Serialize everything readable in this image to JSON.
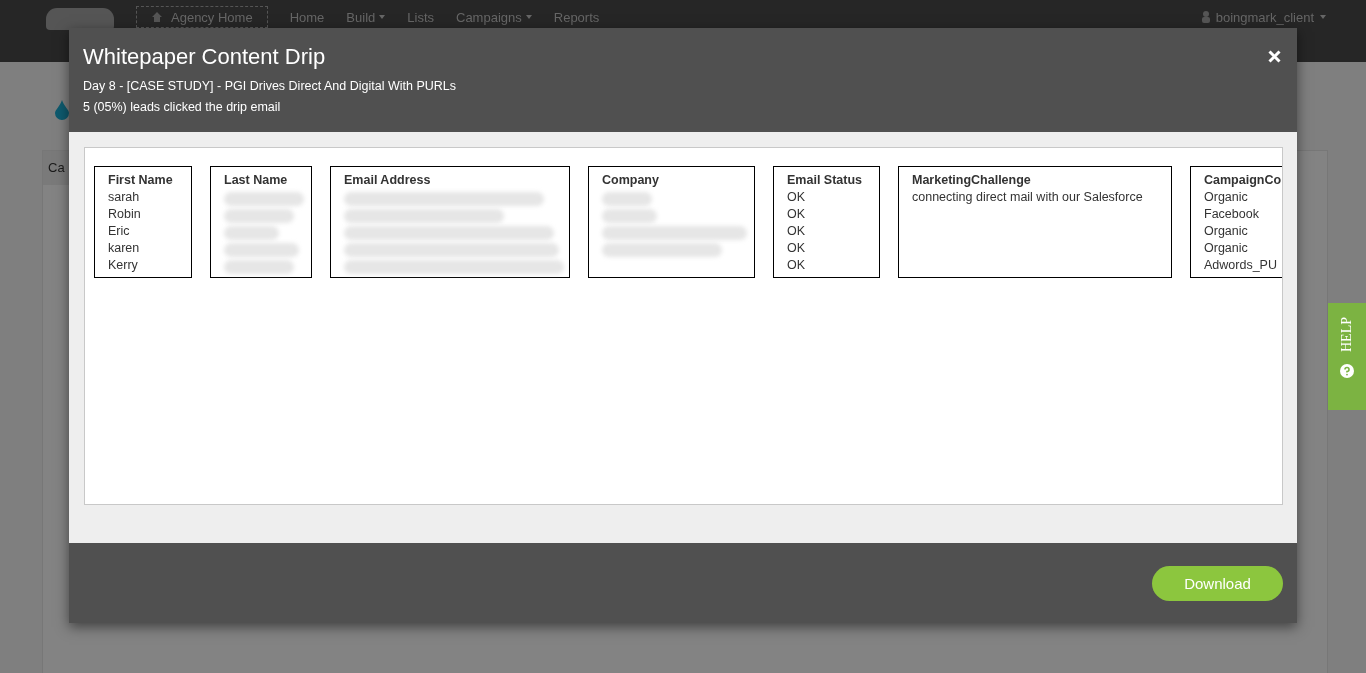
{
  "nav": {
    "agency_home": "Agency Home",
    "items": [
      {
        "label": "Home",
        "dropdown": false
      },
      {
        "label": "Build",
        "dropdown": true
      },
      {
        "label": "Lists",
        "dropdown": false
      },
      {
        "label": "Campaigns",
        "dropdown": true
      },
      {
        "label": "Reports",
        "dropdown": false
      }
    ],
    "user": "boingmark_client"
  },
  "page": {
    "tab": "Ca"
  },
  "modal": {
    "title": "Whitepaper Content Drip",
    "subtitle": "Day 8 - [CASE STUDY] - PGI Drives Direct And Digital With PURLs",
    "summary": "5 (05%) leads clicked the drip email",
    "columns": [
      {
        "heading": "First Name",
        "redacted": false,
        "values": [
          "sarah",
          "Robin",
          "Eric",
          "karen",
          "Kerry"
        ]
      },
      {
        "heading": "Last Name",
        "redacted": true
      },
      {
        "heading": "Email Address",
        "redacted": true
      },
      {
        "heading": "Company",
        "redacted": true
      },
      {
        "heading": "Email Status",
        "redacted": false,
        "values": [
          "OK",
          "OK",
          "OK",
          "OK",
          "OK"
        ]
      },
      {
        "heading": "MarketingChallenge",
        "redacted": false,
        "values": [
          "connecting direct mail with our Salesforce"
        ]
      },
      {
        "heading": "CampaignCo",
        "redacted": false,
        "values": [
          "Organic",
          "Facebook",
          "Organic",
          "Organic",
          "Adwords_PU"
        ]
      }
    ],
    "download": "Download"
  },
  "help": "HELP"
}
